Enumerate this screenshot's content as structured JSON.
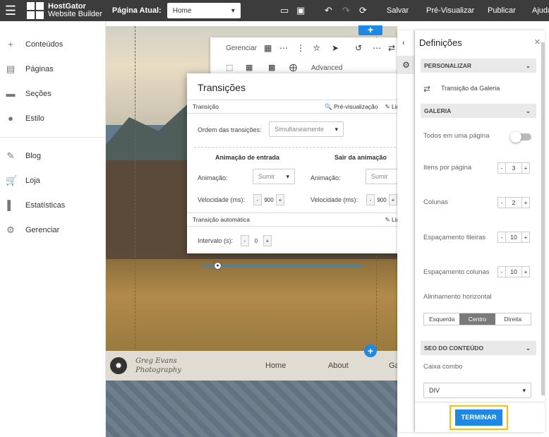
{
  "topbar": {
    "brand_line1": "HostGator",
    "brand_line2": "Website Builder",
    "page_label": "Página Atual:",
    "page_select": "Home",
    "save": "Salvar",
    "preview": "Pré-Visualizar",
    "publish": "Publicar",
    "help": "Ajuda"
  },
  "sidebar": {
    "items": [
      {
        "label": "Conteúdos",
        "icon": "plus-icon"
      },
      {
        "label": "Páginas",
        "icon": "pages-icon"
      },
      {
        "label": "Seções",
        "icon": "sections-icon"
      },
      {
        "label": "Estilo",
        "icon": "palette-icon"
      },
      {
        "label": "Blog",
        "icon": "pencil-icon"
      },
      {
        "label": "Loja",
        "icon": "cart-icon"
      },
      {
        "label": "Estatísticas",
        "icon": "stats-icon"
      },
      {
        "label": "Gerenciar",
        "icon": "gear-icon"
      }
    ]
  },
  "canvas": {
    "logo_line1": "Greg Evans",
    "logo_line2": "Photography",
    "nav": [
      "Home",
      "About",
      "Ga"
    ]
  },
  "toolbar": {
    "manage": "Gerenciar",
    "advanced": "Advanced"
  },
  "dialog": {
    "title": "Transições",
    "section1": "Transição",
    "preview": "Pré-visualização",
    "clear": "Limpar",
    "order_label": "Ordem das transições:",
    "order_value": "Simultaneamente",
    "enter_title": "Animação de entrada",
    "exit_title": "Sair da animação",
    "animation_label": "Animação:",
    "animation_value": "Sumir",
    "speed_label": "Velocidade (ms):",
    "speed_value": "900",
    "section2": "Transição automática",
    "interval_label": "Intervalo (s):",
    "interval_value": "0"
  },
  "panel": {
    "title": "Definições",
    "personalize": "PERSONALIZAR",
    "gallery_transition": "Transição da Galeria",
    "gallery": "GALERIA",
    "all_one_page": "Todos em uma página",
    "items_per_page": "Itens por página",
    "items_per_page_value": "3",
    "columns": "Colunas",
    "columns_value": "2",
    "row_spacing": "Espaçamento fileiras",
    "row_spacing_value": "10",
    "col_spacing": "Espaçamento colunas",
    "col_spacing_value": "10",
    "h_align": "Alinhamento horizontal",
    "align_left": "Esquerda",
    "align_center": "Centro",
    "align_right": "Direita",
    "seo": "SEO DO CONTEÚDO",
    "combo_label": "Caixa combo",
    "combo_value": "DIV",
    "finish": "TERMINAR"
  }
}
